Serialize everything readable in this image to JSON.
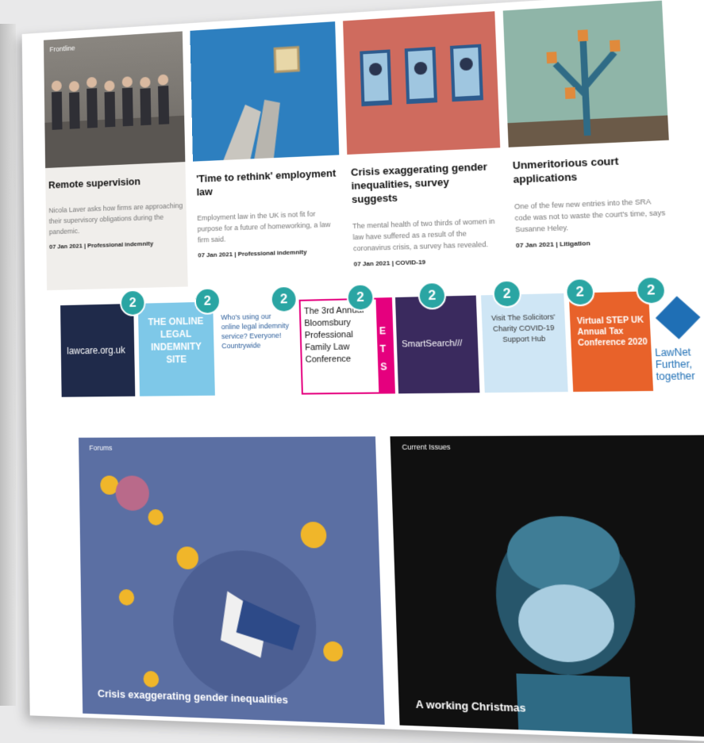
{
  "frontline_label": "Frontline",
  "cards": [
    {
      "title": "Remote supervision",
      "desc": "Nicola Laver asks how firms are approaching their supervisory obligations during the pandemic.",
      "date": "07 Jan 2021",
      "category": "Professional indemnity"
    },
    {
      "title": "'Time to rethink' employment law",
      "desc": "Employment law in the UK is not fit for purpose for a future of homeworking, a law firm said.",
      "date": "07 Jan 2021",
      "category": "Professional indemnity"
    },
    {
      "title": "Crisis exaggerating gender inequalities, survey suggests",
      "desc": "The mental health of two thirds of women in law have suffered as a result of the coronavirus crisis, a survey has revealed.",
      "date": "07 Jan 2021",
      "category": "COVID-19"
    },
    {
      "title": "Unmeritorious court applications",
      "desc": "One of the few new entries into the SRA code was not to waste the court's time, says Susanne Heley.",
      "date": "07 Jan 2021",
      "category": "Litigation"
    }
  ],
  "badge_value": "2",
  "sponsors": [
    {
      "text": "lawcare.org.uk"
    },
    {
      "text": "THE ONLINE LEGAL INDEMNITY SITE"
    },
    {
      "text": "Who's using our online legal indemnity service? Everyone! Countrywide"
    },
    {
      "text": "The 3rd Annual Bloomsbury Professional Family Law Conference"
    },
    {
      "text": "E T S"
    },
    {
      "text": "SmartSearch///"
    },
    {
      "text": "Visit The Solicitors' Charity COVID-19 Support Hub"
    },
    {
      "text": "Virtual STEP UK Annual Tax Conference 2020"
    },
    {
      "text": "LawNet Further, together"
    }
  ],
  "forums": {
    "label": "Forums",
    "caption": "Crisis exaggerating gender inequalities"
  },
  "current": {
    "label": "Current Issues",
    "caption": "A working Christmas"
  },
  "colors": {
    "accent": "#2aa5a3",
    "navy": "#1f2a4a",
    "lightblue": "#7ec8e8"
  }
}
